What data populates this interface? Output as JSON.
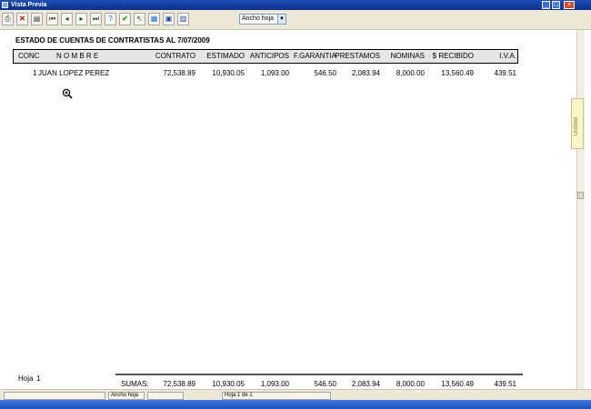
{
  "window": {
    "title": "Vista Previa"
  },
  "toolbar": {
    "zoom_value": "Ancho hoja"
  },
  "side_tab": {
    "label": "Untitled"
  },
  "report": {
    "title": "ESTADO DE CUENTAS DE CONTRATISTAS AL 7/07/2009",
    "headers": [
      "CONC",
      "N O M B R E",
      "CONTRATO",
      "ESTIMADO",
      "ANTICIPOS",
      "F.GARANTIA",
      "PRESTAMOS",
      "NOMINAS",
      "$ RECIBIDO",
      "I.V.A."
    ],
    "rows": [
      [
        "1",
        "JUAN LOPEZ PEREZ",
        "72,538.89",
        "10,930.05",
        "1,093.00",
        "546.50",
        "2,083.94",
        "8,000.00",
        "13,560.49",
        "439.51"
      ]
    ],
    "footer": {
      "page_label": "Hoja",
      "page_number": "1",
      "sums_label": "SUMAS:",
      "sums": [
        "72,538.89",
        "10,930.05",
        "1,093.00",
        "546.50",
        "2,083.94",
        "8,000.00",
        "13,560.49",
        "439.51"
      ]
    }
  },
  "status": {
    "zoom": "Ancho hoja",
    "page": "Hoja 1 de 1"
  }
}
